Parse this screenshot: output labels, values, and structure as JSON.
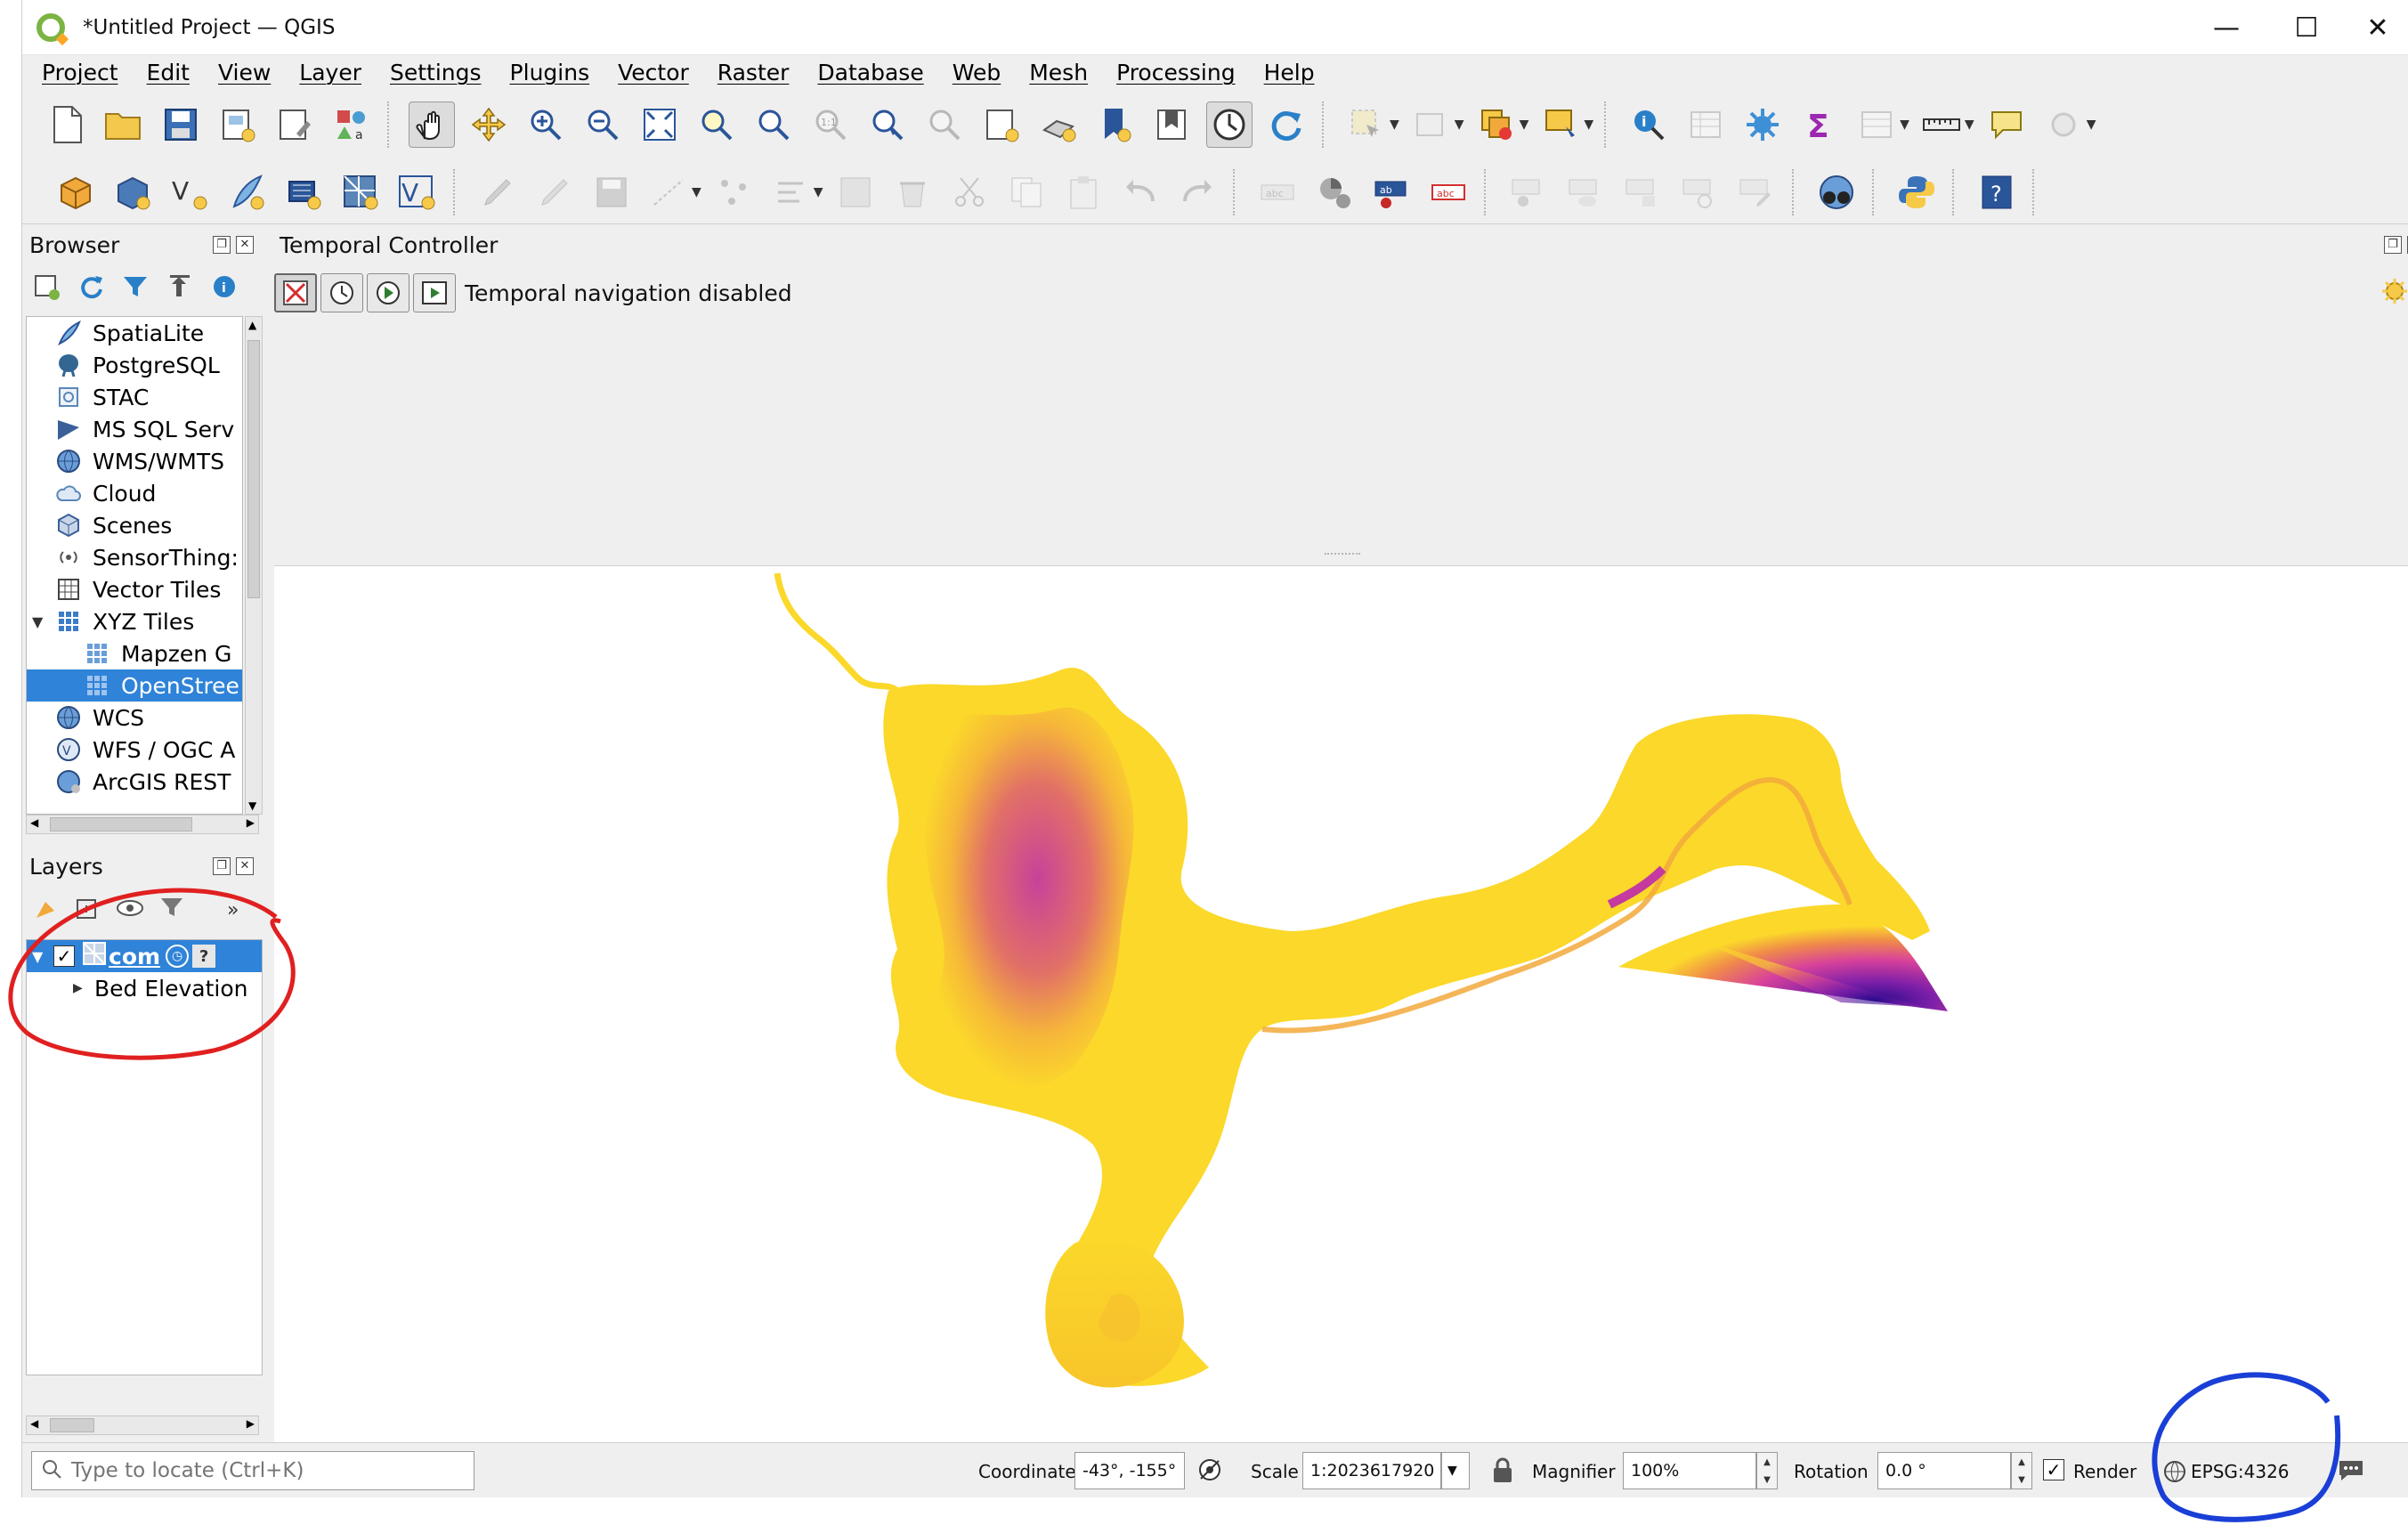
{
  "window": {
    "title": "*Untitled Project — QGIS",
    "minimize": "—",
    "maximize": "☐",
    "close": "✕"
  },
  "menu": [
    "Project",
    "Edit",
    "View",
    "Layer",
    "Settings",
    "Plugins",
    "Vector",
    "Raster",
    "Database",
    "Web",
    "Mesh",
    "Processing",
    "Help"
  ],
  "browser": {
    "title": "Browser",
    "items": [
      {
        "label": "SpatiaLite",
        "icon": "spatialite-icon"
      },
      {
        "label": "PostgreSQL",
        "icon": "postgresql-icon"
      },
      {
        "label": "STAC",
        "icon": "stac-icon"
      },
      {
        "label": "MS SQL Serv",
        "icon": "mssql-icon"
      },
      {
        "label": "WMS/WMTS",
        "icon": "wms-icon"
      },
      {
        "label": "Cloud",
        "icon": "cloud-icon"
      },
      {
        "label": "Scenes",
        "icon": "scenes-icon"
      },
      {
        "label": "SensorThing:",
        "icon": "sensorthings-icon"
      },
      {
        "label": "Vector Tiles",
        "icon": "vector-tiles-icon"
      },
      {
        "label": "XYZ Tiles",
        "icon": "xyz-tiles-icon"
      },
      {
        "label": "Mapzen G",
        "icon": "xyz-tile-icon"
      },
      {
        "label": "OpenStree",
        "icon": "xyz-tile-icon"
      },
      {
        "label": "WCS",
        "icon": "wcs-icon"
      },
      {
        "label": "WFS / OGC A",
        "icon": "wfs-icon"
      },
      {
        "label": "ArcGIS REST",
        "icon": "arcgis-icon"
      }
    ]
  },
  "layers": {
    "title": "Layers",
    "layer_name": "com",
    "group_label": "Bed Elevation"
  },
  "temporal": {
    "title": "Temporal Controller",
    "status": "Temporal navigation disabled"
  },
  "status": {
    "locator_placeholder": "Type to locate (Ctrl+K)",
    "coordinate_label": "Coordinate",
    "coordinate_value": "-43°, -155°",
    "scale_label": "Scale",
    "scale_value": "1:2023617920",
    "magnifier_label": "Magnifier",
    "magnifier_value": "100%",
    "rotation_label": "Rotation",
    "rotation_value": "0.0 °",
    "render_label": "Render",
    "render_checked": true,
    "crs": "EPSG:4326"
  },
  "colors": {
    "selection": "#2f83d8",
    "annotation_red": "#e02020",
    "annotation_blue": "#1a3fd6",
    "mesh_low": "#fde724",
    "mesh_mid": "#d8429a",
    "mesh_high": "#3b0fa8"
  }
}
